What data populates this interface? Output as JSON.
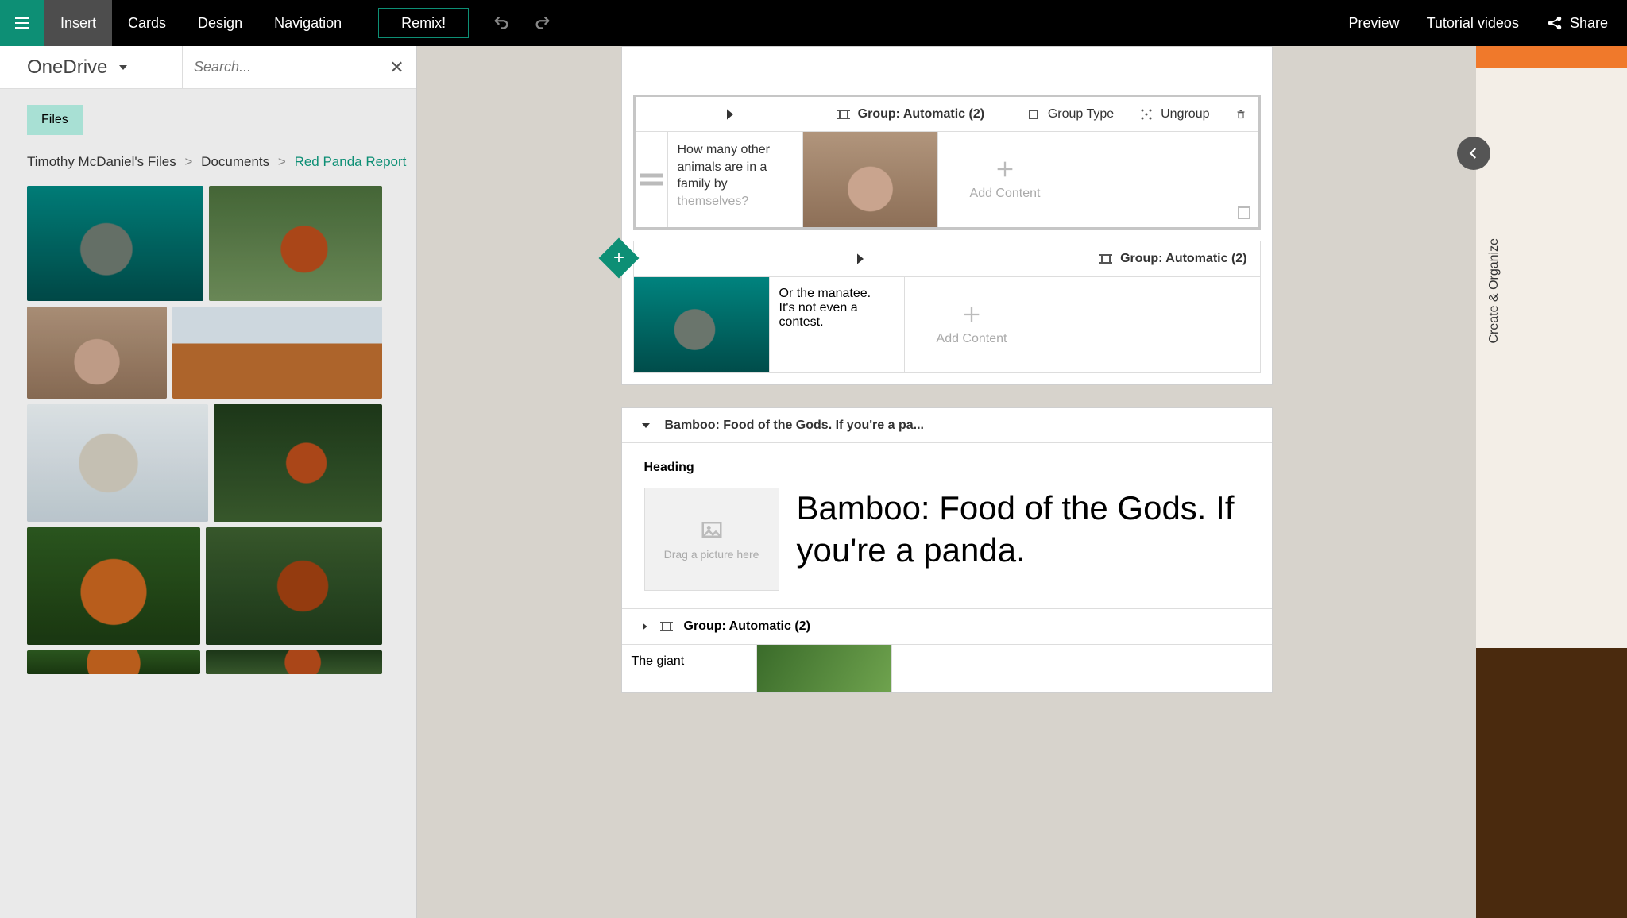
{
  "topbar": {
    "tabs": {
      "insert": "Insert",
      "cards": "Cards",
      "design": "Design",
      "navigation": "Navigation"
    },
    "remix": "Remix!",
    "preview": "Preview",
    "tutorial": "Tutorial videos",
    "share": "Share"
  },
  "left": {
    "source": "OneDrive",
    "search_placeholder": "Search...",
    "files_pill": "Files",
    "breadcrumb": {
      "root": "Timothy McDaniel's Files",
      "mid": "Documents",
      "current": "Red Panda Report"
    }
  },
  "canvas": {
    "group1": {
      "title": "Group: Automatic (2)",
      "group_type": "Group Type",
      "ungroup": "Ungroup",
      "text": "How many other animals are in a family by",
      "text_fade": "themselves?",
      "add": "Add Content"
    },
    "group2": {
      "title": "Group: Automatic (2)",
      "text": "Or the manatee.\nIt's not even a contest.",
      "add": "Add Content"
    },
    "section2": {
      "collapsed_title": "Bamboo: Food of the Gods. If you're a pa...",
      "heading_label": "Heading",
      "drop_hint": "Drag a picture here",
      "heading_text": "Bamboo: Food of the Gods. If you're a panda."
    },
    "group3": {
      "title": "Group: Automatic (2)",
      "text": "The giant"
    }
  },
  "right_rail": {
    "label": "Create & Organize"
  }
}
